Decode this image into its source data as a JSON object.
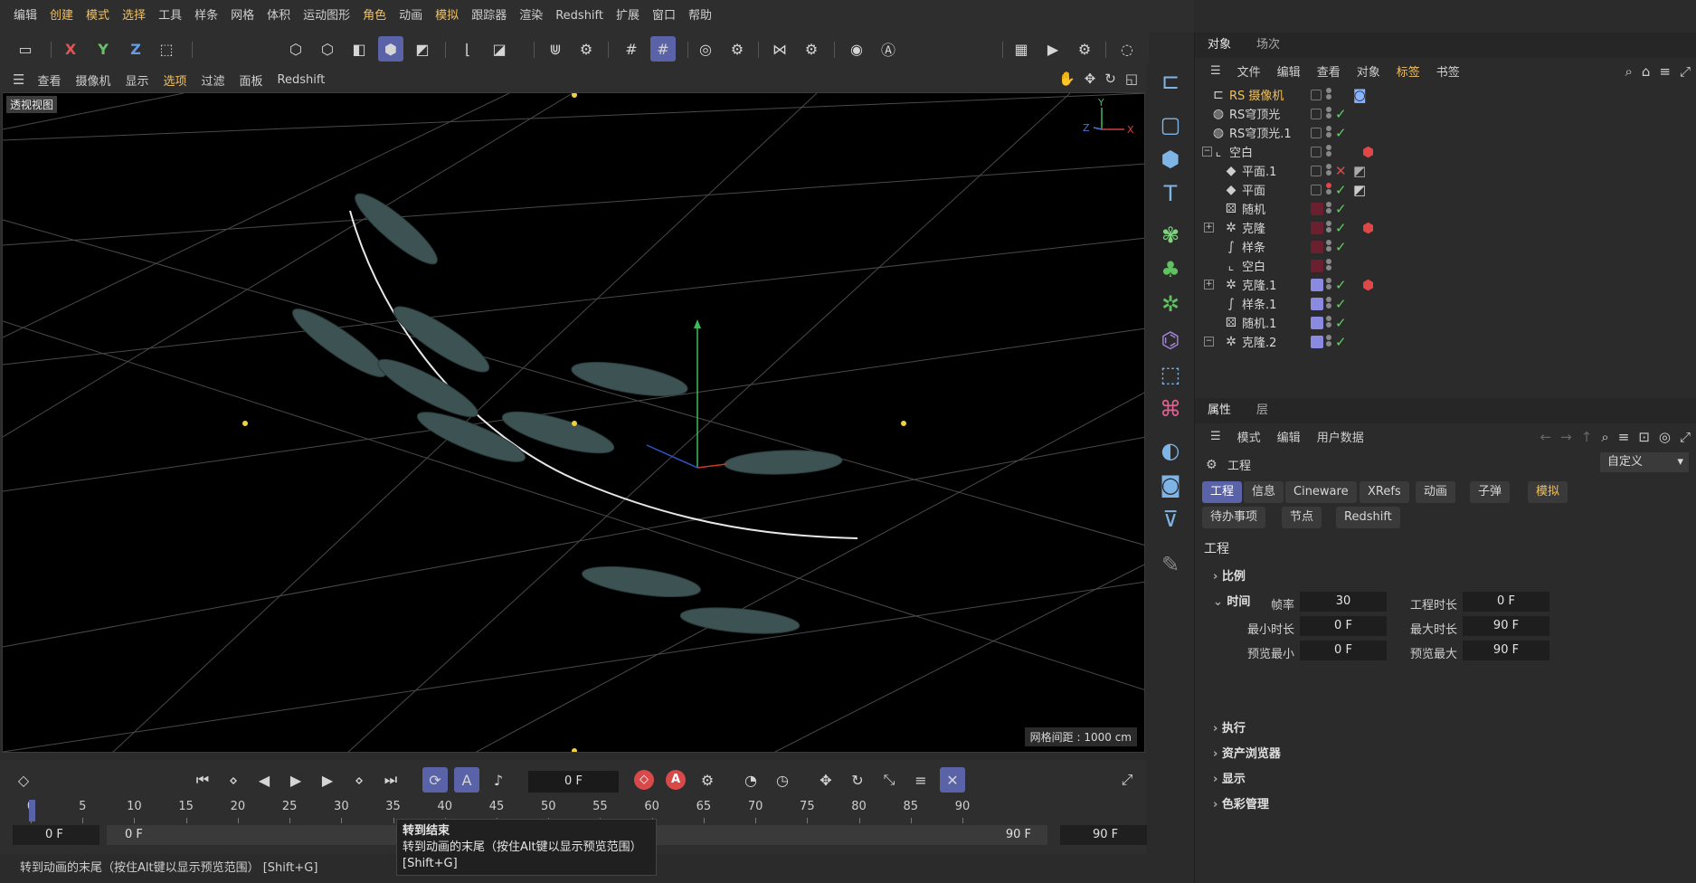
{
  "menubar": [
    "编辑",
    "创建",
    "模式",
    "选择",
    "工具",
    "样条",
    "网格",
    "体积",
    "运动图形",
    "角色",
    "动画",
    "模拟",
    "跟踪器",
    "渲染",
    "Redshift",
    "扩展",
    "窗口",
    "帮助"
  ],
  "toolbar": {
    "axis_x": "X",
    "axis_y": "Y",
    "axis_z": "Z"
  },
  "viewport_menu": [
    "查看",
    "摄像机",
    "显示",
    "选项",
    "过滤",
    "面板",
    "Redshift"
  ],
  "viewport": {
    "label": "透视视图",
    "grid_spacing": "网格间距 : 1000 cm",
    "axis_y": "Y",
    "axis_z": "Z",
    "axis_x": "X"
  },
  "timeline": {
    "current_frame": "0 F",
    "ruler_ticks": [
      "0",
      "5",
      "10",
      "15",
      "20",
      "25",
      "30",
      "35",
      "40",
      "45",
      "50",
      "55",
      "60",
      "65",
      "70",
      "75",
      "80",
      "85",
      "90"
    ],
    "range_start": "0 F",
    "range_inner_start": "0 F",
    "range_inner_end": "90 F",
    "range_end": "90 F"
  },
  "tooltip": {
    "title": "转到结束",
    "line1": "转到动画的末尾（按住Alt键以显示预览范围）",
    "line2": "[Shift+G]"
  },
  "status_text": "转到动画的末尾（按住Alt键以显示预览范围） [Shift+G]",
  "object_panel": {
    "tabs": [
      "对象",
      "场次"
    ],
    "menu": [
      "文件",
      "编辑",
      "查看",
      "对象",
      "标签",
      "书签"
    ],
    "rows": [
      {
        "name": "RS 摄像机",
        "highlight": true,
        "icon": "camera-icon",
        "glyph": "⊏",
        "indent": 0
      },
      {
        "name": "RS穹顶光",
        "icon": "dome-light-icon",
        "glyph": "◍",
        "indent": 0
      },
      {
        "name": "RS穹顶光.1",
        "icon": "dome-light-icon",
        "glyph": "◍",
        "indent": 0
      },
      {
        "name": "空白",
        "icon": "null-icon",
        "glyph": "⌞",
        "indent": 0,
        "expand": "−"
      },
      {
        "name": "平面.1",
        "icon": "plane-icon",
        "glyph": "◆",
        "indent": 1
      },
      {
        "name": "平面",
        "icon": "plane-icon",
        "glyph": "◆",
        "indent": 1
      },
      {
        "name": "随机",
        "icon": "random-effector-icon",
        "glyph": "⚄",
        "indent": 1
      },
      {
        "name": "克隆",
        "icon": "cloner-icon",
        "glyph": "✲",
        "indent": 1,
        "expand": "+"
      },
      {
        "name": "样条",
        "icon": "spline-icon",
        "glyph": "∫",
        "indent": 1
      },
      {
        "name": "空白",
        "icon": "null-icon",
        "glyph": "⌞",
        "indent": 1
      },
      {
        "name": "克隆.1",
        "icon": "cloner-icon",
        "glyph": "✲",
        "indent": 1,
        "expand": "+"
      },
      {
        "name": "样条.1",
        "icon": "spline-icon",
        "glyph": "∫",
        "indent": 1
      },
      {
        "name": "随机.1",
        "icon": "random-effector-icon",
        "glyph": "⚄",
        "indent": 1
      },
      {
        "name": "克隆.2",
        "icon": "cloner-icon",
        "glyph": "✲",
        "indent": 1,
        "expand": "−"
      }
    ]
  },
  "attr_panel": {
    "tabs": [
      "属性",
      "层"
    ],
    "menu": [
      "模式",
      "编辑",
      "用户数据"
    ],
    "header": "工程",
    "preset": "自定义",
    "subtabs_row1": [
      "工程",
      "信息",
      "Cineware",
      "XRefs",
      "动画",
      "子弹",
      "模拟"
    ],
    "subtabs_row2": [
      "待办事项",
      "节点",
      "Redshift"
    ],
    "section_title": "工程",
    "groups": [
      "比例",
      "时间",
      "执行",
      "资产浏览器",
      "显示",
      "色彩管理"
    ],
    "fields": {
      "fps_label": "帧率",
      "fps": "30",
      "duration_label": "工程时长",
      "duration": "0 F",
      "min_label": "最小时长",
      "min": "0 F",
      "max_label": "最大时长",
      "max": "90 F",
      "pmin_label": "预览最小",
      "pmin": "0 F",
      "pmax_label": "预览最大",
      "pmax": "90 F"
    }
  }
}
